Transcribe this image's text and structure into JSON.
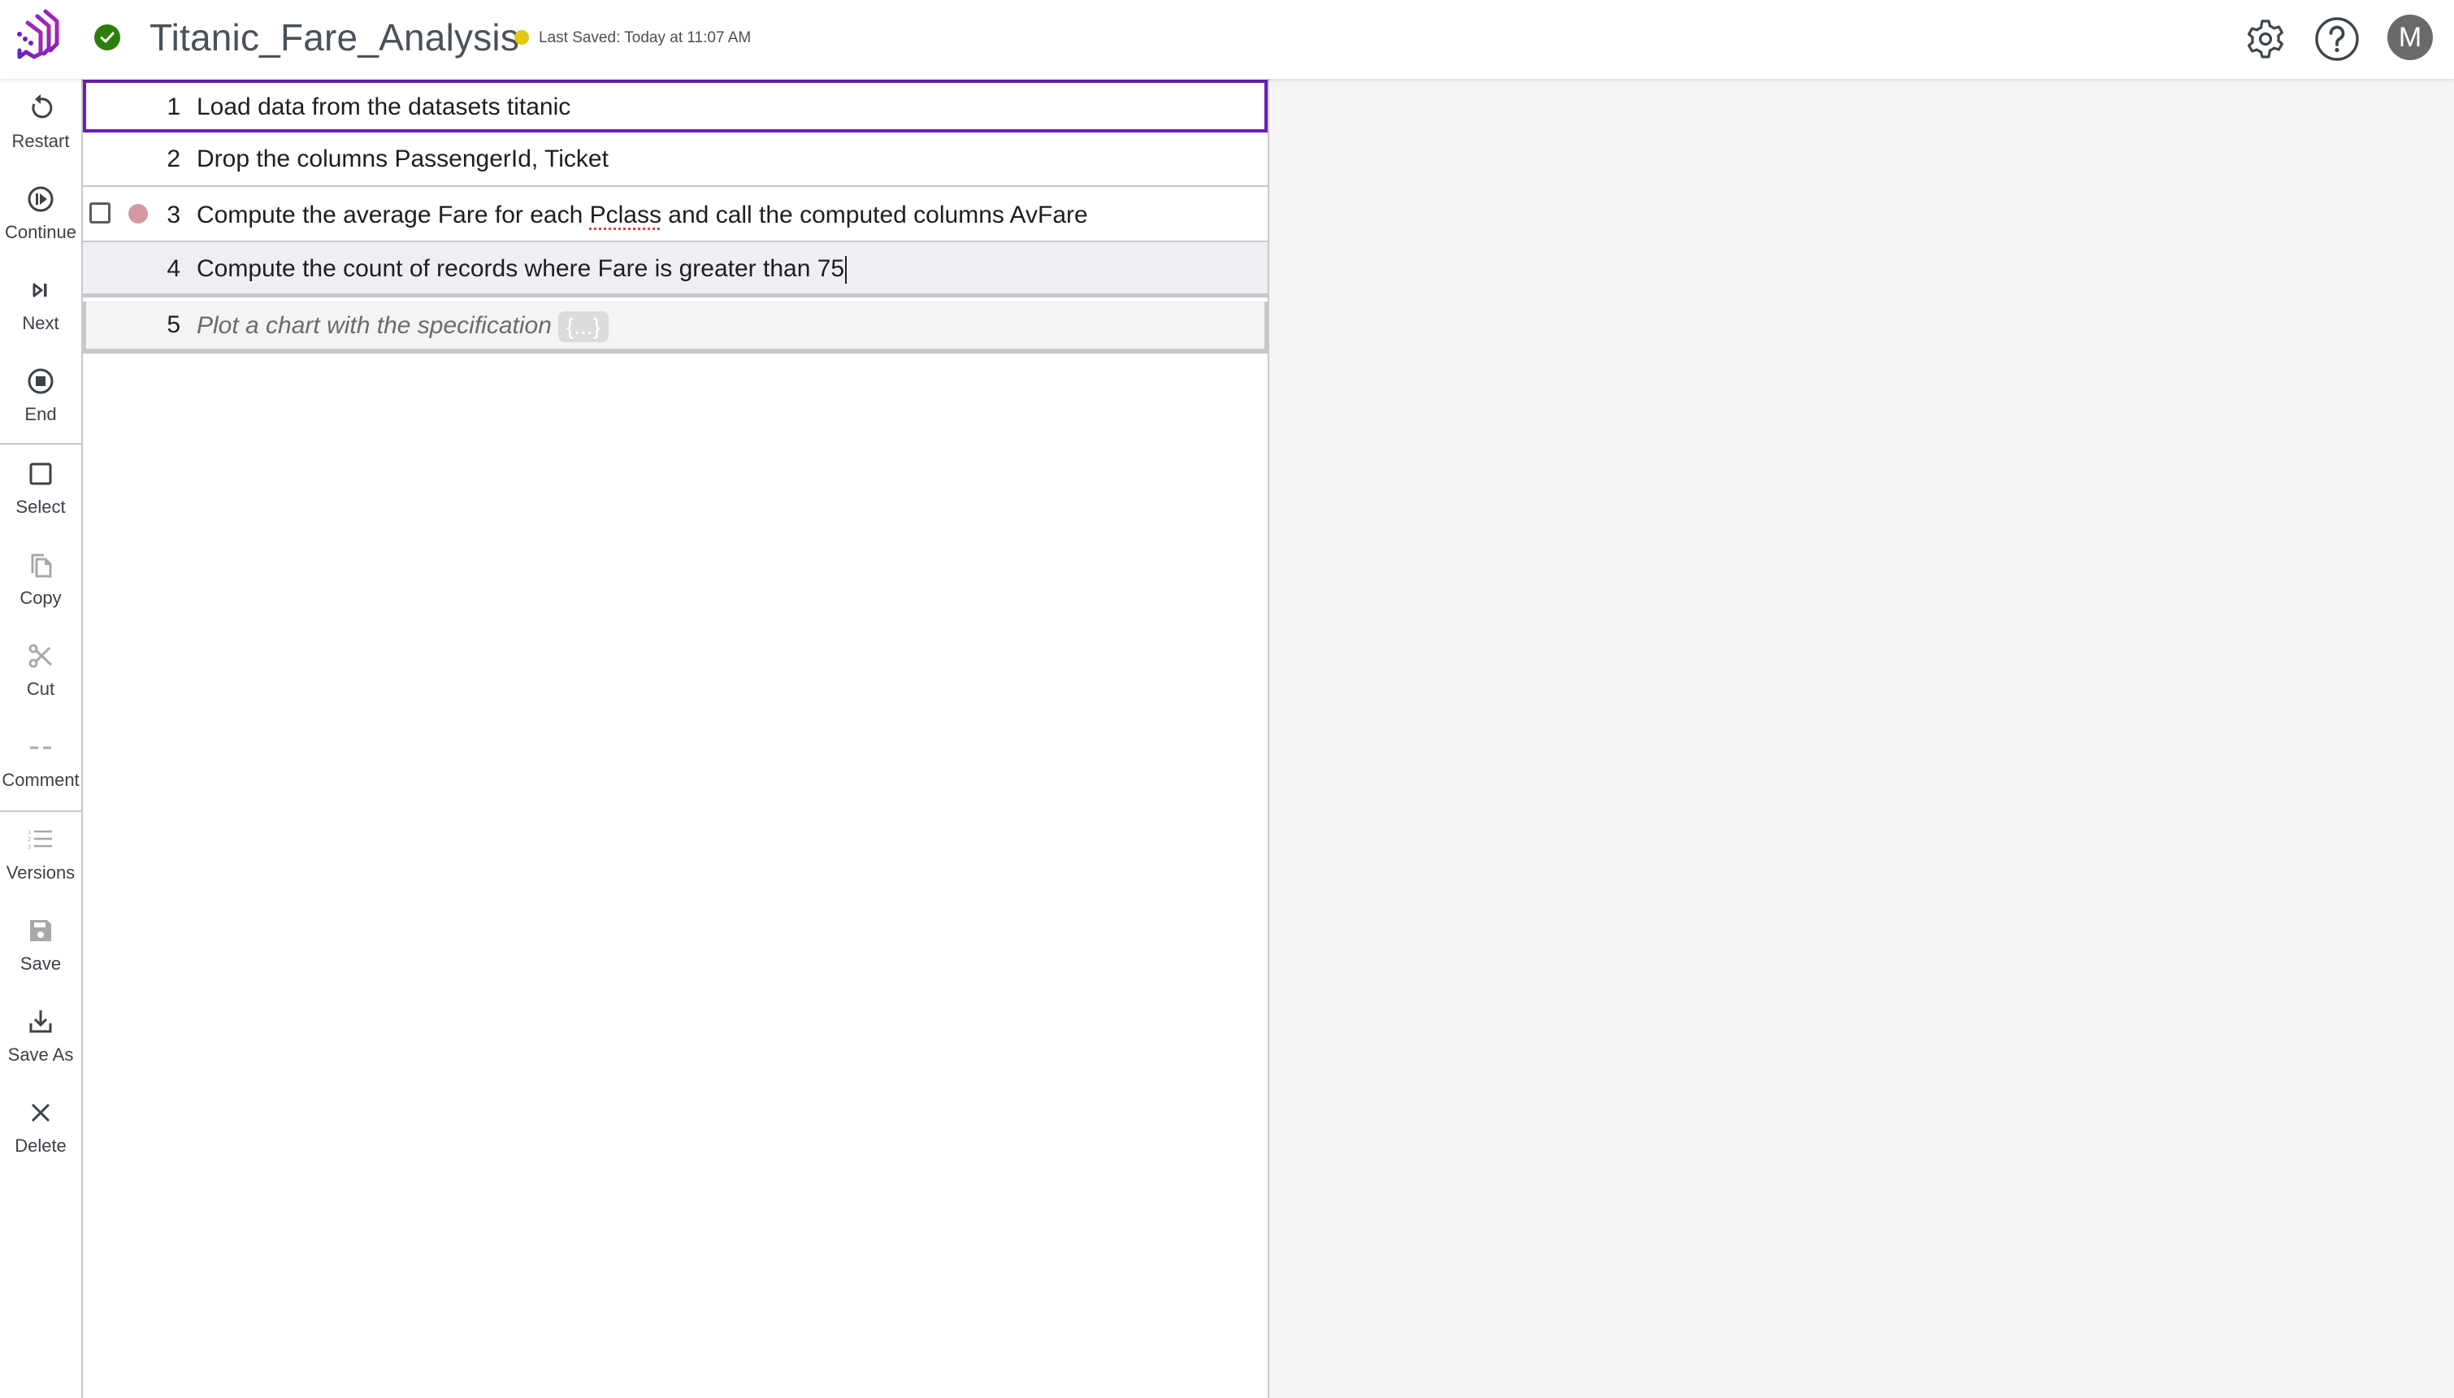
{
  "header": {
    "logo_icon": "chat-stack-logo-icon",
    "status_icon": "check-circle-icon",
    "title": "Titanic_Fare_Analysis",
    "unsaved_indicator_color": "#e2c80f",
    "last_saved": "Last Saved: Today at 11:07 AM",
    "settings_icon": "gear-icon",
    "help_icon": "help-circle-icon",
    "avatar_initial": "M"
  },
  "sidebar": {
    "items": [
      {
        "label": "Restart",
        "icon": "restart-icon"
      },
      {
        "label": "Continue",
        "icon": "continue-icon"
      },
      {
        "label": "Next",
        "icon": "step-next-icon"
      },
      {
        "label": "End",
        "icon": "stop-icon"
      },
      {
        "label": "Select",
        "icon": "select-square-icon"
      },
      {
        "label": "Copy",
        "icon": "copy-icon"
      },
      {
        "label": "Cut",
        "icon": "scissors-icon"
      },
      {
        "label": "Comment",
        "icon": "comment-dashes-icon"
      },
      {
        "label": "Versions",
        "icon": "numbered-list-icon"
      },
      {
        "label": "Save",
        "icon": "floppy-disk-icon"
      },
      {
        "label": "Save As",
        "icon": "download-tray-icon"
      },
      {
        "label": "Delete",
        "icon": "close-x-icon"
      }
    ]
  },
  "notebook": {
    "rows": [
      {
        "number": "1",
        "text": "Load data from the datasets titanic",
        "state": "selected"
      },
      {
        "number": "2",
        "text": "Drop the columns PassengerId, Ticket"
      },
      {
        "number": "3",
        "text_before": "Compute the average Fare for each ",
        "text_misspelled": "Pclass",
        "text_after": " and call the computed columns AvFare",
        "has_checkbox": true,
        "checked": false,
        "breakpoint_color": "#d4979f"
      },
      {
        "number": "4",
        "text": "Compute the count of records where Fare is greater than 75",
        "state": "editing"
      },
      {
        "number": "5",
        "text": "Plot a chart with the specification",
        "badge": "{...}",
        "state": "placeholder"
      }
    ]
  },
  "colors": {
    "accent": "#6a1fb0",
    "success": "#2e7d0d",
    "text_primary": "#1e1e1e",
    "text_secondary": "#4a5158"
  }
}
